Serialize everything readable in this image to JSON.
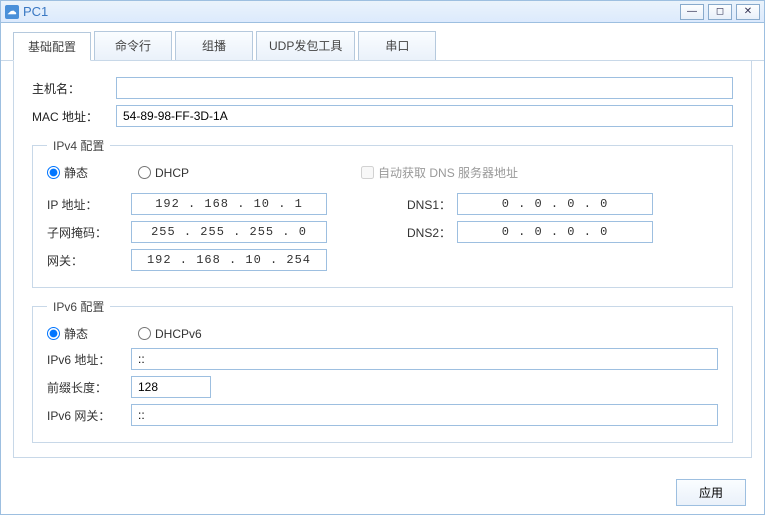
{
  "window": {
    "title": "PC1"
  },
  "tabs": {
    "basic": "基础配置",
    "cmd": "命令行",
    "multicast": "组播",
    "udp": "UDP发包工具",
    "serial": "串口"
  },
  "hostname": {
    "label": "主机名：",
    "value": ""
  },
  "mac": {
    "label": "MAC 地址：",
    "value": "54-89-98-FF-3D-1A"
  },
  "ipv4": {
    "legend": "IPv4 配置",
    "static_label": "静态",
    "dhcp_label": "DHCP",
    "auto_dns_label": "自动获取 DNS 服务器地址",
    "ip_label": "IP 地址：",
    "ip_value": "192  .  168  .   10   .   1",
    "mask_label": "子网掩码：",
    "mask_value": "255  .  255  .  255  .   0",
    "gw_label": "网关：",
    "gw_value": "192  .  168  .   10   .  254",
    "dns1_label": "DNS1：",
    "dns1_value": "0   .   0   .   0   .   0",
    "dns2_label": "DNS2：",
    "dns2_value": "0   .   0   .   0   .   0"
  },
  "ipv6": {
    "legend": "IPv6 配置",
    "static_label": "静态",
    "dhcpv6_label": "DHCPv6",
    "addr_label": "IPv6 地址：",
    "addr_value": "::",
    "prefix_label": "前缀长度：",
    "prefix_value": "128",
    "gw_label": "IPv6 网关：",
    "gw_value": "::"
  },
  "footer": {
    "apply": "应用"
  }
}
